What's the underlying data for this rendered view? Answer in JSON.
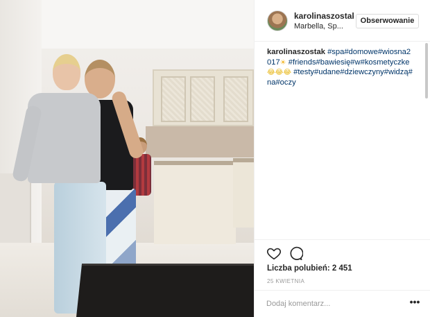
{
  "post": {
    "image_alt": "photo",
    "header": {
      "username": "karolinaszostak",
      "location": "Marbella, Sp...",
      "follow_label": "Obserwowanie"
    },
    "caption": {
      "username": "karolinaszostak",
      "segments": [
        {
          "text": "#spa",
          "type": "tag"
        },
        {
          "text": "#domowe",
          "type": "tag"
        },
        {
          "text": "#wiosna2017",
          "type": "tag"
        },
        {
          "text": "#friends",
          "type": "tag"
        },
        {
          "text": "#bawiesię",
          "type": "tag"
        },
        {
          "text": "#w",
          "type": "tag"
        },
        {
          "text": "#kosmetyczke",
          "type": "tag"
        },
        {
          "text": "#testy",
          "type": "tag"
        },
        {
          "text": "#udane",
          "type": "tag"
        },
        {
          "text": "#dziewczyny",
          "type": "tag"
        },
        {
          "text": "#widzą",
          "type": "tag"
        },
        {
          "text": "#na",
          "type": "tag"
        },
        {
          "text": "#oczy",
          "type": "tag"
        }
      ],
      "line1_tags": "#spa#domowe#wiosna2017",
      "line2_tags": "#friends#bawiesię#w#kosmetyczke",
      "line3_tags": "#testy#udane#dziewczyny#widzą#na#oczy",
      "emoji_sun": "☀",
      "emoji_cry": "😂😂",
      "emoji_cry2": "😂"
    },
    "actions": {
      "like_icon": "heart-icon",
      "comment_icon": "comment-icon"
    },
    "likes_text": "Liczba polubień: 2 451",
    "date": "25 KWIETNIA",
    "comment_placeholder": "Dodaj komentarz...",
    "more_label": "•••"
  },
  "colors": {
    "text": "#262626",
    "hashtag": "#003569",
    "muted": "#999999",
    "border": "#efefef"
  }
}
